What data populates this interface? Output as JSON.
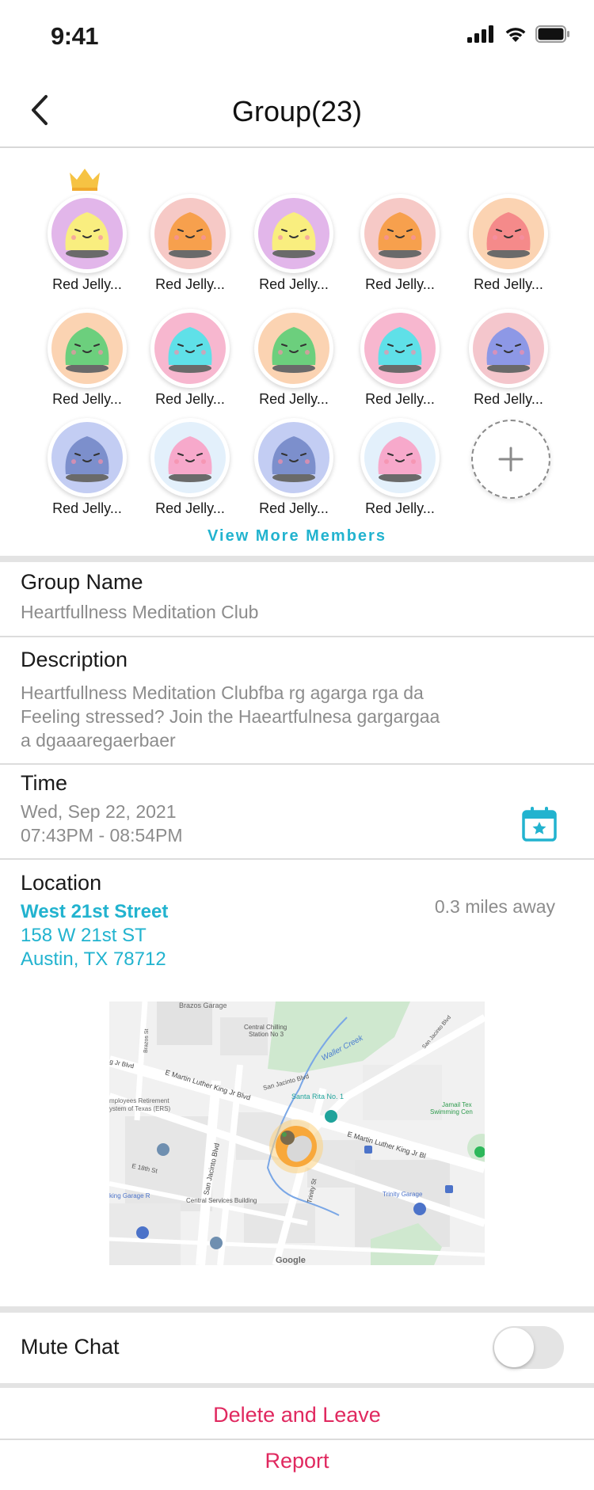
{
  "status_bar": {
    "time": "9:41"
  },
  "header": {
    "title": "Group(23)"
  },
  "members": {
    "items": [
      {
        "name": "Red Jelly...",
        "body": "#f9ee7f",
        "bg": "#e2b6ea",
        "owner": true
      },
      {
        "name": "Red Jelly...",
        "body": "#f7a04d",
        "bg": "#f6c9c6"
      },
      {
        "name": "Red Jelly...",
        "body": "#f9ee7f",
        "bg": "#e2b6ea"
      },
      {
        "name": "Red Jelly...",
        "body": "#f7a04d",
        "bg": "#f6c9c6"
      },
      {
        "name": "Red Jelly...",
        "body": "#f58a8a",
        "bg": "#fbd3b2"
      },
      {
        "name": "Red Jelly...",
        "body": "#6ccf7d",
        "bg": "#fbd3b2"
      },
      {
        "name": "Red Jelly...",
        "body": "#5fe0e8",
        "bg": "#f7b7cf"
      },
      {
        "name": "Red Jelly...",
        "body": "#6ccf7d",
        "bg": "#fbd3b2"
      },
      {
        "name": "Red Jelly...",
        "body": "#5fe0e8",
        "bg": "#f7b7cf"
      },
      {
        "name": "Red Jelly...",
        "body": "#8d98e6",
        "bg": "#f4c6cc"
      },
      {
        "name": "Red Jelly...",
        "body": "#7c8fcc",
        "bg": "#c3cdf3"
      },
      {
        "name": "Red Jelly...",
        "body": "#f7a9cb",
        "bg": "#e3f0fb"
      },
      {
        "name": "Red Jelly...",
        "body": "#7c8fcc",
        "bg": "#c3cdf3"
      },
      {
        "name": "Red Jelly...",
        "body": "#f7a9cb",
        "bg": "#e3f0fb"
      }
    ],
    "view_more": "View More Members"
  },
  "group_name": {
    "label": "Group Name",
    "value": "Heartfullness Meditation Club"
  },
  "description": {
    "label": "Description",
    "lines": [
      "Heartfullness Meditation Clubfba rg agarga rga da",
      "Feeling stressed? Join the Haeartfulnesa gargargaa",
      "a dgaaaregaerbaer"
    ]
  },
  "time": {
    "label": "Time",
    "date": "Wed, Sep 22, 2021",
    "range": "07:43PM - 08:54PM"
  },
  "location": {
    "label": "Location",
    "name": "West 21st Street",
    "street": "158 W 21st ST",
    "city": "Austin, TX 78712",
    "distance": "0.3 miles away"
  },
  "map": {
    "labels": {
      "brazos_garage": "Brazos Garage",
      "chilling_1": "Central Chilling",
      "chilling_2": "Station No 3",
      "waller": "Waller Creek",
      "san_jacinto_top": "San Jacinto Blvd",
      "mlk_left": "E Martin Luther King Jr Blvd",
      "santa_rita": "Santa Rita No. 1",
      "ers_1": "mployees Retirement",
      "ers_2": "ystem of Texas (ERS)",
      "jamail": "Jamail Tex",
      "jamail_2": "Swimming Cen",
      "mlk_right": "E Martin Luther King Jr Bl",
      "san_jacinto_v": "San Jacinto Blvd",
      "trinity_st": "Trinity St",
      "e18": "E 18th St",
      "garage_r": "king Garage R",
      "central_services": "Central Services Building",
      "trinity_garage": "Trinity Garage",
      "brazos_st": "Brazos St",
      "jr_blvd": "g Jr Blvd",
      "sanjac_right": "San Jacinto Blvd",
      "google": "Google"
    }
  },
  "settings": {
    "mute_label": "Mute Chat",
    "mute_on": false
  },
  "actions": {
    "delete_leave": "Delete and Leave",
    "report": "Report"
  },
  "colors": {
    "accent": "#22b3cf",
    "danger": "#e0285f",
    "muted_text": "#8c8c8c"
  }
}
